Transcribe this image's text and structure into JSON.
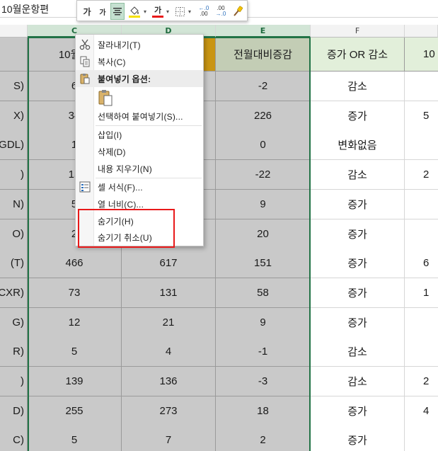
{
  "sheet_title": "10월운항편",
  "column_headers": [
    "C",
    "D",
    "E",
    "F"
  ],
  "table_header": {
    "c": "10월운",
    "d": "",
    "e": "전월대비증감",
    "f": "증가 OR 감소",
    "g": "10"
  },
  "rows": [
    {
      "a": "S)",
      "c": "6",
      "d": "",
      "e": "-2",
      "f": "감소",
      "g": ""
    },
    {
      "a": "X)",
      "c": "34",
      "d": "",
      "e": "226",
      "f": "증가",
      "g": "5"
    },
    {
      "a": "GDL)",
      "c": "1",
      "d": "",
      "e": "0",
      "f": "변화없음",
      "g": ""
    },
    {
      "a": ")",
      "c": "15",
      "d": "",
      "e": "-22",
      "f": "감소",
      "g": "2"
    },
    {
      "a": "N)",
      "c": "5",
      "d": "",
      "e": "9",
      "f": "증가",
      "g": ""
    },
    {
      "a": "O)",
      "c": "2",
      "d": "",
      "e": "20",
      "f": "증가",
      "g": ""
    },
    {
      "a": "(T)",
      "c": "466",
      "d": "617",
      "e": "151",
      "f": "증가",
      "g": "6"
    },
    {
      "a": "CXR)",
      "c": "73",
      "d": "131",
      "e": "58",
      "f": "증가",
      "g": "1"
    },
    {
      "a": "G)",
      "c": "12",
      "d": "21",
      "e": "9",
      "f": "증가",
      "g": ""
    },
    {
      "a": "R)",
      "c": "5",
      "d": "4",
      "e": "-1",
      "f": "감소",
      "g": ""
    },
    {
      "a": ")",
      "c": "139",
      "d": "136",
      "e": "-3",
      "f": "감소",
      "g": "2"
    },
    {
      "a": "D)",
      "c": "255",
      "d": "273",
      "e": "18",
      "f": "증가",
      "g": "4"
    },
    {
      "a": "C)",
      "c": "5",
      "d": "7",
      "e": "2",
      "f": "증가",
      "g": ""
    }
  ],
  "mini_toolbar": {
    "grow_font": "가",
    "shrink_font": "가",
    "font_color_glyph": "가",
    "font_color": "#e8191a",
    "icons": [
      "grow-font-icon",
      "shrink-font-icon",
      "align-center-icon",
      "fill-color-icon",
      "font-color-icon",
      "borders-icon",
      "increase-decimal-icon",
      "decrease-decimal-icon",
      "format-painter-icon"
    ]
  },
  "context_menu": {
    "cut": "잘라내기(T)",
    "copy": "복사(C)",
    "paste_options": "붙여넣기 옵션:",
    "paste_special": "선택하여 붙여넣기(S)...",
    "insert": "삽입(I)",
    "delete": "삭제(D)",
    "clear_contents": "내용 지우기(N)",
    "format_cells": "셀 서식(F)...",
    "column_width": "열 너비(C)...",
    "hide": "숨기기(H)",
    "unhide": "숨기기 취소(U)"
  },
  "colors": {
    "selection": "#217346",
    "header_gold": "#c99512",
    "header_sage": "#c3cdb5",
    "header_mint": "#e2efda",
    "cell_gray": "#c9c9c9",
    "highlight_box": "#e8191a"
  }
}
